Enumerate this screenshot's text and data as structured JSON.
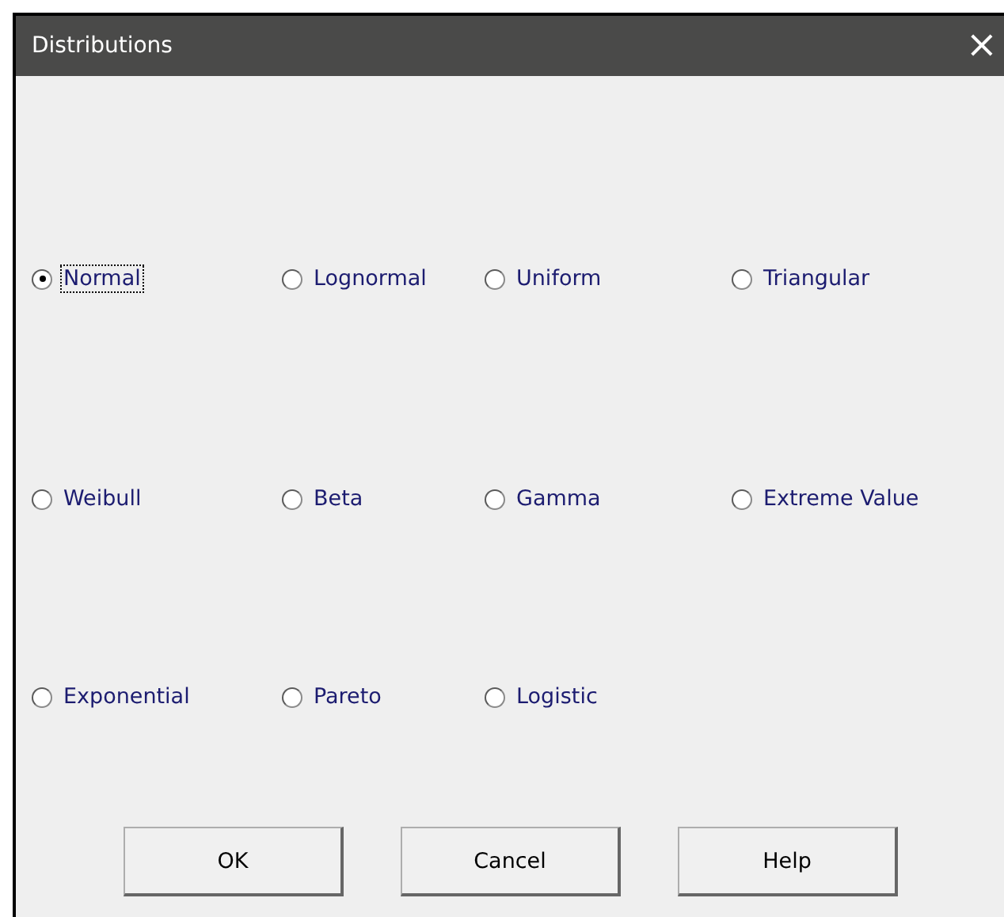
{
  "window": {
    "title": "Distributions",
    "close": "×"
  },
  "options": [
    [
      {
        "label": "Normal",
        "selected": true,
        "focused": true
      },
      {
        "label": "Lognormal",
        "selected": false,
        "focused": false
      },
      {
        "label": "Uniform",
        "selected": false,
        "focused": false
      },
      {
        "label": "Triangular",
        "selected": false,
        "focused": false
      }
    ],
    [
      {
        "label": "Weibull",
        "selected": false,
        "focused": false
      },
      {
        "label": "Beta",
        "selected": false,
        "focused": false
      },
      {
        "label": "Gamma",
        "selected": false,
        "focused": false
      },
      {
        "label": "Extreme Value",
        "selected": false,
        "focused": false
      }
    ],
    [
      {
        "label": "Exponential",
        "selected": false,
        "focused": false
      },
      {
        "label": "Pareto",
        "selected": false,
        "focused": false
      },
      {
        "label": "Logistic",
        "selected": false,
        "focused": false
      }
    ]
  ],
  "buttons": [
    "OK",
    "Cancel",
    "Help"
  ]
}
